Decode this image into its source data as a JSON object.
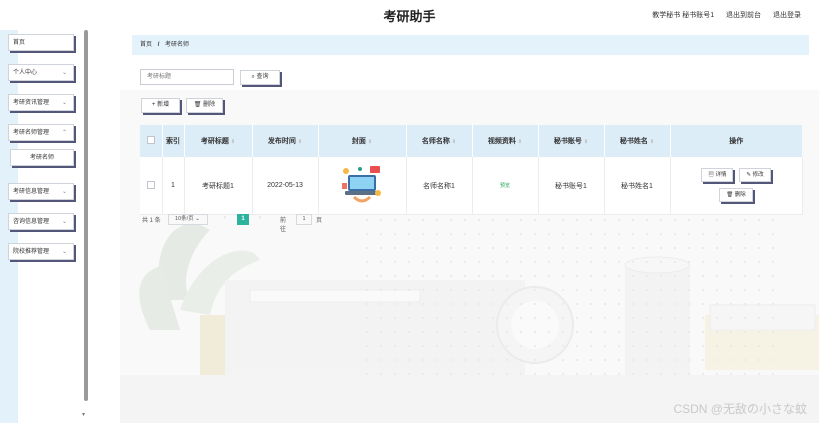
{
  "header": {
    "title": "考研助手",
    "links": [
      "教学秘书 秘书账号1",
      "退出到前台",
      "退出登录"
    ]
  },
  "sidebar": {
    "items": [
      {
        "label": "首页",
        "has_chevron": false
      },
      {
        "label": "个人中心",
        "has_chevron": true
      },
      {
        "label": "考研资讯管理",
        "has_chevron": true
      },
      {
        "label": "考研名师管理",
        "has_chevron": true
      },
      {
        "label": "考研名师",
        "has_chevron": false
      },
      {
        "label": "考研信息管理",
        "has_chevron": true
      },
      {
        "label": "咨询信息管理",
        "has_chevron": true
      },
      {
        "label": "院校推荐管理",
        "has_chevron": true
      }
    ]
  },
  "breadcrumb": {
    "home": "首页",
    "separator": "/",
    "current": "考研名师"
  },
  "search": {
    "placeholder": "考研标题",
    "button": "查询"
  },
  "toolbar": {
    "add": "新增",
    "delete": "删除"
  },
  "table": {
    "headers": [
      "索引",
      "考研标题",
      "发布时间",
      "封面",
      "名师名称",
      "视频资料",
      "秘书账号",
      "秘书姓名",
      "操作"
    ],
    "rows": [
      {
        "index": "1",
        "title": "考研标题1",
        "date": "2022-05-13",
        "cover": "cover-image",
        "teacher": "名师名称1",
        "video": "预览",
        "account": "秘书账号1",
        "name": "秘书姓名1",
        "actions": [
          "详情",
          "修改",
          "删除"
        ]
      }
    ]
  },
  "pagination": {
    "total": "共 1 条",
    "page_size": "10条/页",
    "current": "1",
    "goto": "前往",
    "goto_value": "1",
    "unit": "页"
  },
  "watermark": "CSDN @无敌の小さな蚊",
  "colors": {
    "accent": "#2db29d",
    "header_bg": "#dcedf8",
    "sidebar_bg": "#e3f1fa",
    "button_shadow": "#54577a"
  }
}
